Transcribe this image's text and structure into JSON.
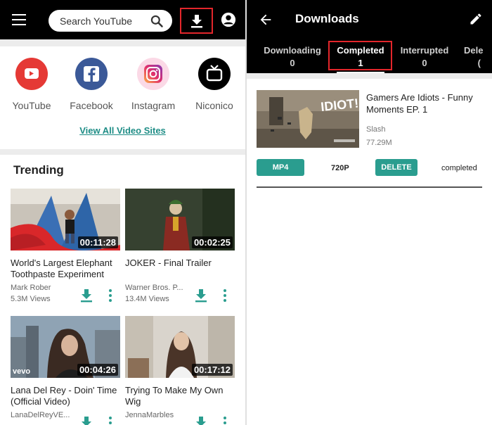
{
  "left": {
    "search": {
      "placeholder": "Search YouTube"
    },
    "icons": {
      "menu": "menu-icon",
      "search": "search-icon",
      "download": "download-icon",
      "account": "account-icon"
    },
    "sites": [
      {
        "label": "YouTube",
        "icon": "youtube-icon",
        "color": "#e53935"
      },
      {
        "label": "Facebook",
        "icon": "facebook-icon",
        "color": "#3b5998"
      },
      {
        "label": "Instagram",
        "icon": "instagram-icon",
        "color": "#e1306c"
      },
      {
        "label": "Niconico",
        "icon": "niconico-icon",
        "color": "#000000"
      }
    ],
    "view_all": "View All Video Sites",
    "trending_title": "Trending",
    "videos": [
      {
        "title": "World's Largest Elephant Toothpaste Experiment",
        "channel": "Mark Rober",
        "views": "5.3M Views",
        "duration": "00:11:28"
      },
      {
        "title": "JOKER - Final Trailer",
        "channel": "Warner Bros. P...",
        "views": "13.4M Views",
        "duration": "00:02:25"
      },
      {
        "title": "Lana Del Rey - Doin' Time (Official Video)",
        "channel": "LanaDelReyVE...",
        "views": "",
        "duration": "00:04:26",
        "watermark": "vevo"
      },
      {
        "title": "Trying To Make My Own Wig",
        "channel": "JennaMarbles",
        "views": "",
        "duration": "00:17:12"
      }
    ]
  },
  "right": {
    "title": "Downloads",
    "tabs": [
      {
        "label": "Downloading",
        "count": "0"
      },
      {
        "label": "Completed",
        "count": "1"
      },
      {
        "label": "Interrupted",
        "count": "0"
      },
      {
        "label": "Dele",
        "count": "("
      }
    ],
    "item": {
      "title": "Gamers Are Idiots - Funny Moments EP. 1",
      "thumb_text": "IDIOT!",
      "author": "Slash",
      "size": "77.29M",
      "format": "MP4",
      "resolution": "720P",
      "delete_label": "DELETE",
      "status": "completed"
    }
  },
  "colors": {
    "accent": "#2a9d8f",
    "highlight": "#e3262b",
    "bar": "#000000"
  }
}
